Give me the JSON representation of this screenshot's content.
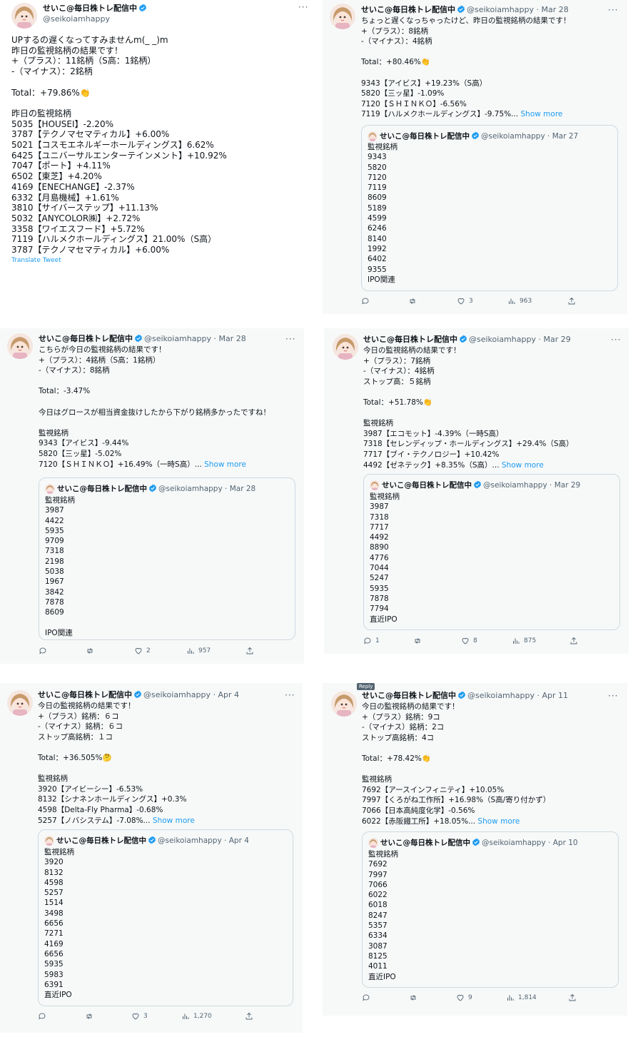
{
  "author": {
    "name": "せいこ@毎日株トレ配信中",
    "handle": "@seikoiamhappy",
    "verified": true
  },
  "icons": {
    "verified": "verified-badge-icon",
    "more": "more-dots-icon",
    "reply": "reply-icon",
    "retweet": "retweet-icon",
    "like": "like-icon",
    "views": "views-icon",
    "share": "share-icon"
  },
  "colors": {
    "accent": "#1d9bf0",
    "muted": "#536471",
    "panel": "#f7f9f9"
  },
  "show_more_label": "Show more",
  "tweets": [
    {
      "date": "",
      "text": "UPするの遅くなってすみませんm(_ _)m\n昨日の監視銘柄の結果です！\n+（プラス）：11銘柄（S高：1銘柄）\n-（マイナス）：2銘柄\n\nTotal：+79.86%👏\n\n昨日の監視銘柄\n5035【HOUSEI】-2.20%\n3787【テクノマセマティカル】+6.00%\n5021【コスモエネルギーホールディングス】6.62%\n6425【ユニバーサルエンターテインメント】+10.92%\n7047【ポート】+4.11%\n6502【東芝】+4.20%\n4169【ENECHANGE】-2.37%\n6332【月島機械】+1.61%\n3810【サイバーステップ】+11.13%\n5032【ANYCOLOR㈱】+2.72%\n3358【ワイエスフード】+5.72%\n7119【ハルメクホールディングス】21.00%（S高）\n3787【テクノマセマティカル】+6.00%",
      "translate_label": "Translate Tweet"
    },
    {
      "date": "Mar 28",
      "text": "ちょっと遅くなっちゃったけど、昨日の監視銘柄の結果です！\n+（プラス）：8銘柄\n-（マイナス）：4銘柄\n\nTotal：+80.46%👏\n\n9343【アイビス】+19.23%（S高）\n5820【三ッ星】-1.09%\n7120【ＳＨＩＮＫＯ】-6.56%\n7119【ハルメクホールディングス】-9.75%...",
      "quote": {
        "date": "Mar 27",
        "text": "監視銘柄\n9343\n5820\n7120\n7119\n8609\n5189\n4599\n6246\n8140\n1992\n6402\n9355\nIPO関連"
      },
      "stats": {
        "reply": "",
        "retweet": "",
        "like": "3",
        "views": "963"
      }
    },
    {
      "date": "Mar 28",
      "text": "こちらが今日の監視銘柄の結果です！\n+（プラス）：4銘柄（S高：1銘柄）\n-（マイナス）：8銘柄\n\nTotal：-3.47%\n\n今日はグロースが相当資金抜けしたから下がり銘柄多かったですね！\n\n監視銘柄\n9343【アイビス】-9.44%\n5820【三ッ星】-5.02%\n7120【ＳＨＩＮＫＯ】+16.49%（一時S高）...",
      "quote": {
        "date": "Mar 28",
        "text": "監視銘柄\n3987\n4422\n5935\n9709\n7318\n2198\n5038\n1967\n3842\n7878\n8609\n\nIPO関連"
      },
      "stats": {
        "reply": "",
        "retweet": "",
        "like": "2",
        "views": "957"
      }
    },
    {
      "date": "Mar 29",
      "text": "今日の監視銘柄の結果です！\n+（プラス）：7銘柄\n-（マイナス）：4銘柄\nストップ高：５銘柄\n\nTotal：+51.78%👏\n\n監視銘柄\n3987【エコモット】-4.39%（一時S高）\n7318【セレンディップ・ホールディングス】+29.4%（S高）\n7717【ブイ・テクノロジー】+10.42%\n4492【ゼネテック】+8.35%（S高）...",
      "quote": {
        "date": "Mar 29",
        "text": "監視銘柄\n3987\n7318\n7717\n4492\n8890\n4776\n7044\n5247\n5935\n7878\n7794\n直近IPO"
      },
      "stats": {
        "reply": "1",
        "retweet": "",
        "like": "8",
        "views": "875"
      }
    },
    {
      "date": "Apr 4",
      "text": "今日の監視銘柄の結果です！\n+（プラス）銘柄：６コ\n-（マイナス）銘柄：６コ\nストップ高銘柄：１コ\n\nTotal：+36.505%🤔\n\n監視銘柄\n3920【アイビーシー】-6.53%\n8132【シナネンホールディングス】+0.3%\n4598【Delta-Fly Pharma】-0.68%\n5257【ノバシステム】-7.08%...",
      "quote": {
        "date": "Apr 4",
        "text": "監視銘柄\n3920\n8132\n4598\n5257\n1514\n3498\n6656\n7271\n4169\n6656\n5935\n5983\n6391\n直近IPO"
      },
      "stats": {
        "reply": "",
        "retweet": "",
        "like": "3",
        "views": "1,270"
      }
    },
    {
      "date": "Apr 11",
      "text": "今日の監視銘柄の結果です！\n+（プラス）銘柄：9コ\n-（マイナス）銘柄：2コ\nストップ高銘柄：4コ\n\nTotal：+78.42%👏\n\n監視銘柄\n7692【アースインフィニティ】+10.05%\n7997【くろがね工作所】+16.98%（S高/寄り付かず）\n7066【日本高純度化学】-0.56%\n6022【赤阪鐵工所】+18.05%...",
      "quote": {
        "date": "Apr 10",
        "text": "監視銘柄\n7692\n7997\n7066\n6022\n6018\n8247\n5357\n6334\n3087\n8125\n4011\n直近IPO"
      },
      "stats": {
        "reply": "",
        "retweet": "",
        "like": "9",
        "views": "1,814"
      },
      "tooltip": "Reply"
    }
  ]
}
